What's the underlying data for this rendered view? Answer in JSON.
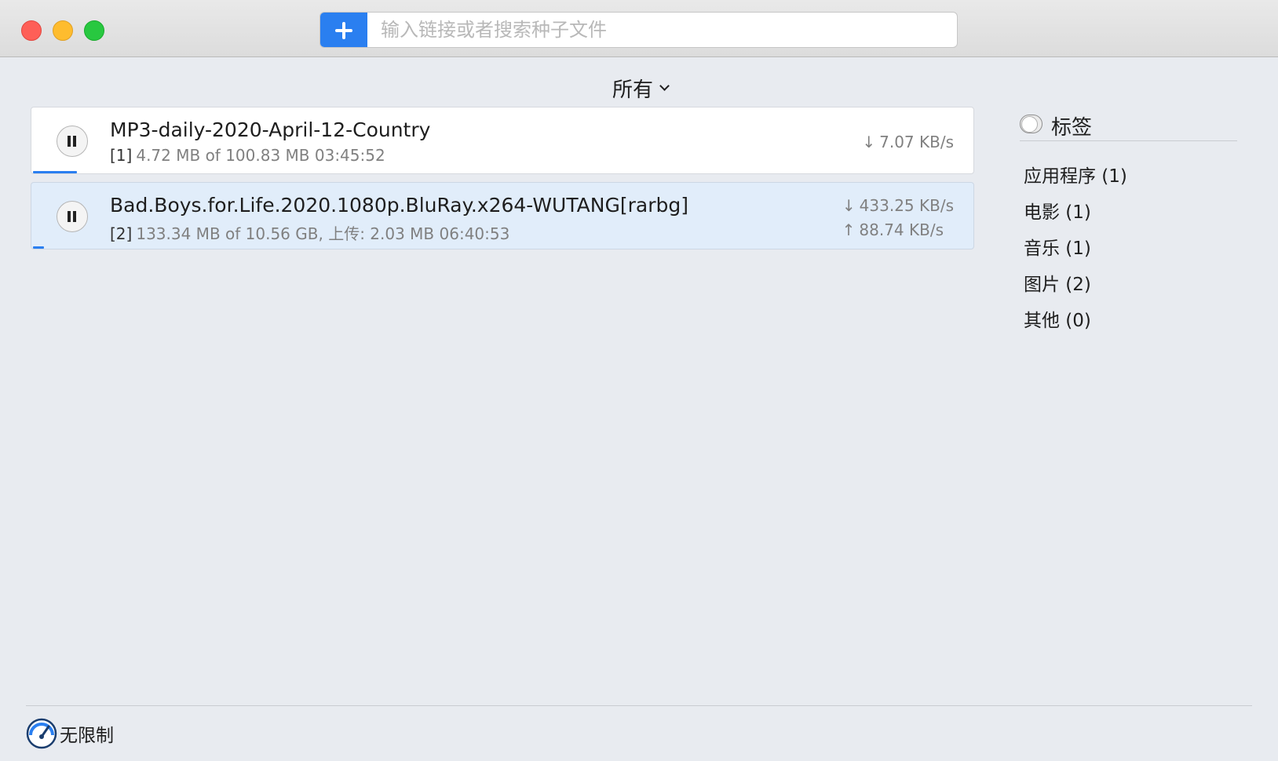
{
  "window": {
    "search": {
      "placeholder": "输入链接或者搜索种子文件"
    },
    "add_button_icon": "plus-icon"
  },
  "filter": {
    "label": "所有"
  },
  "downloads": [
    {
      "name": "MP3-daily-2020-April-12-Country",
      "index": "[1]",
      "meta": "4.72 MB of 100.83 MB 03:45:52",
      "download_speed": "7.07 KB/s",
      "progress": 0.047
    },
    {
      "name": "Bad.Boys.for.Life.2020.1080p.BluRay.x264-WUTANG[rarbg]",
      "index": "[2]",
      "meta": "133.34 MB of 10.56 GB, 上传: 2.03 MB 06:40:53",
      "download_speed": "433.25 KB/s",
      "upload_speed": "88.74 KB/s",
      "progress": 0.012
    }
  ],
  "sidebar": {
    "title": "标签",
    "categories": [
      {
        "label": "应用程序 (1)"
      },
      {
        "label": "电影 (1)"
      },
      {
        "label": "音乐 (1)"
      },
      {
        "label": "图片 (2)"
      },
      {
        "label": "其他 (0)"
      }
    ]
  },
  "footer": {
    "limit_label": "无限制"
  },
  "colors": {
    "accent": "#2a7ff0",
    "selected_row": "#e1edfa",
    "background": "#e8ebf0"
  },
  "symbols": {
    "down_arrow": "↓",
    "up_arrow": "↑"
  }
}
